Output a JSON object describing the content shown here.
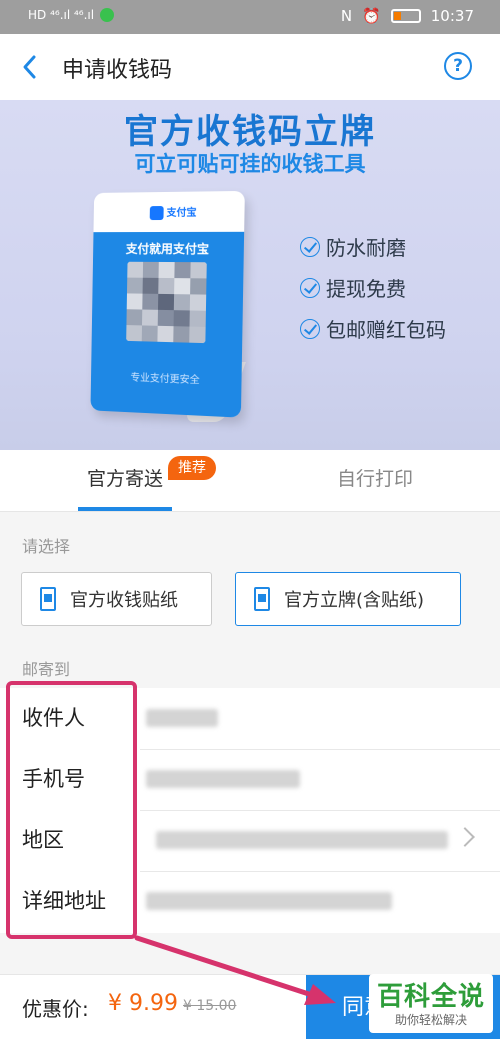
{
  "status_bar": {
    "left_indicators": "HD ⁴⁶.ıl ⁴⁶.ıl",
    "time": "10:37"
  },
  "nav": {
    "title": "申请收钱码",
    "back_icon": "chevron-left-icon",
    "help_icon": "question-circle-icon",
    "help_glyph": "?"
  },
  "banner": {
    "title": "官方收钱码立牌",
    "subtitle": "可立可贴可挂的收钱工具",
    "stand_brand": "支付宝",
    "stand_headline": "支付就用支付宝",
    "stand_footer": "专业支付更安全",
    "features": [
      "防水耐磨",
      "提现免费",
      "包邮赠红包码"
    ]
  },
  "tabs": {
    "items": [
      {
        "label": "官方寄送",
        "active": true
      },
      {
        "label": "自行打印",
        "active": false
      }
    ],
    "badge": "推荐"
  },
  "select": {
    "label": "请选择",
    "options": [
      {
        "label": "官方收钱贴纸",
        "selected": false
      },
      {
        "label": "官方立牌(含贴纸)",
        "selected": true
      }
    ]
  },
  "address": {
    "label": "邮寄到",
    "fields": [
      {
        "label": "收件人"
      },
      {
        "label": "手机号"
      },
      {
        "label": "地区"
      },
      {
        "label": "详细地址"
      }
    ]
  },
  "bottom": {
    "price_label": "优惠价:",
    "price": "¥ 9.99",
    "original_price": "¥ 15.00",
    "agree_button": "同意"
  },
  "watermark": {
    "title": "百科全说",
    "subtitle": "助你轻松解决"
  },
  "colors": {
    "accent": "#1e88e5",
    "badge": "#f4650f",
    "annotation": "#d6336c"
  }
}
